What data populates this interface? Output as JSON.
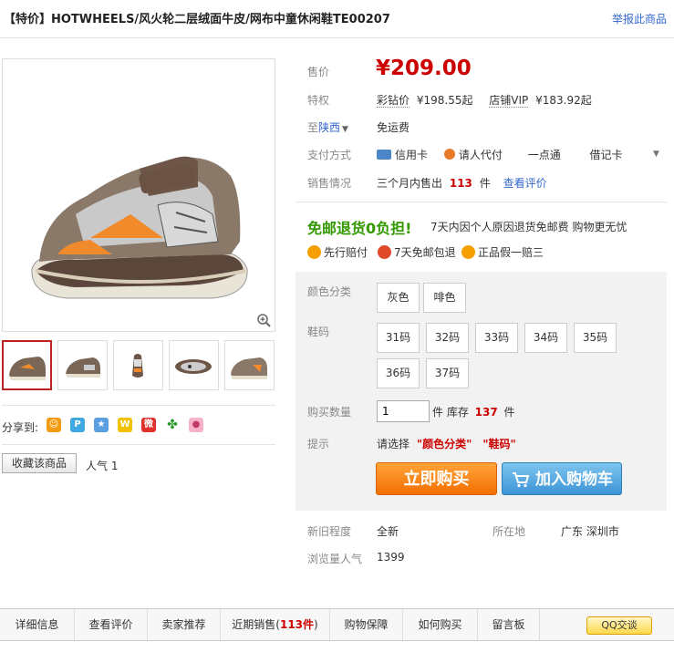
{
  "header": {
    "title": "【特价】HOTWHEELS/风火轮二层绒面牛皮/网布中童休闲鞋TE00207",
    "report_link": "举报此商品"
  },
  "gallery": {
    "thumb_count": 5,
    "active_thumb": 0
  },
  "share": {
    "label": "分享到:",
    "icons": [
      "smile-icon",
      "pengyou-icon",
      "star-icon",
      "microblog-icon",
      "weibo-icon",
      "clover-icon",
      "pig-icon"
    ]
  },
  "favorite": {
    "button": "收藏该商品",
    "popularity": "人气 1"
  },
  "price": {
    "label": "售价",
    "value": "¥209.00"
  },
  "privilege": {
    "label": "特权",
    "diamond_label": "彩钻价",
    "diamond_price": "¥198.55起",
    "vip_label": "店铺VIP",
    "vip_price": "¥183.92起"
  },
  "shipping": {
    "label_prefix": "至",
    "region": "陕西",
    "value": "免运费"
  },
  "payment": {
    "label": "支付方式",
    "methods": [
      "信用卡",
      "请人代付",
      "一点通",
      "借记卡"
    ]
  },
  "sales": {
    "label": "销售情况",
    "prefix": "三个月内售出",
    "count": "113",
    "unit": "件",
    "link": "查看评价"
  },
  "promo": {
    "headline": "免邮退货0负担!",
    "desc": "7天内因个人原因退货免邮费 购物更无忧",
    "badges": [
      "先行赔付",
      "7天免邮包退",
      "正品假一赔三"
    ]
  },
  "sku": {
    "color_label": "颜色分类",
    "colors": [
      "灰色",
      "啡色"
    ],
    "size_label": "鞋码",
    "sizes": [
      "31码",
      "32码",
      "33码",
      "34码",
      "35码",
      "36码",
      "37码"
    ],
    "qty_label": "购买数量",
    "qty_value": "1",
    "stock_prefix": "件 库存",
    "stock": "137",
    "stock_unit": "件",
    "hint_label": "提示",
    "hint_prefix": "请选择",
    "hint_color": "\"颜色分类\"",
    "hint_size": "\"鞋码\""
  },
  "actions": {
    "buy": "立即购买",
    "cart": "加入购物车"
  },
  "details": {
    "condition_label": "新旧程度",
    "condition": "全新",
    "location_label": "所在地",
    "location": "广东 深圳市",
    "views_label": "浏览量人气",
    "views": "1399"
  },
  "tabs": {
    "items": [
      "详细信息",
      "查看评价",
      "卖家推荐",
      "近期销售(",
      "购物保障",
      "如何购买",
      "留言板"
    ],
    "recent_count": "113件",
    "recent_close": ")",
    "qq": "QQ交谈"
  },
  "colors": {
    "price_red": "#cc0000",
    "promo_green": "#339900",
    "buy_orange": "#f36f00",
    "cart_blue": "#3b95d6",
    "link_blue": "#3366cc"
  }
}
